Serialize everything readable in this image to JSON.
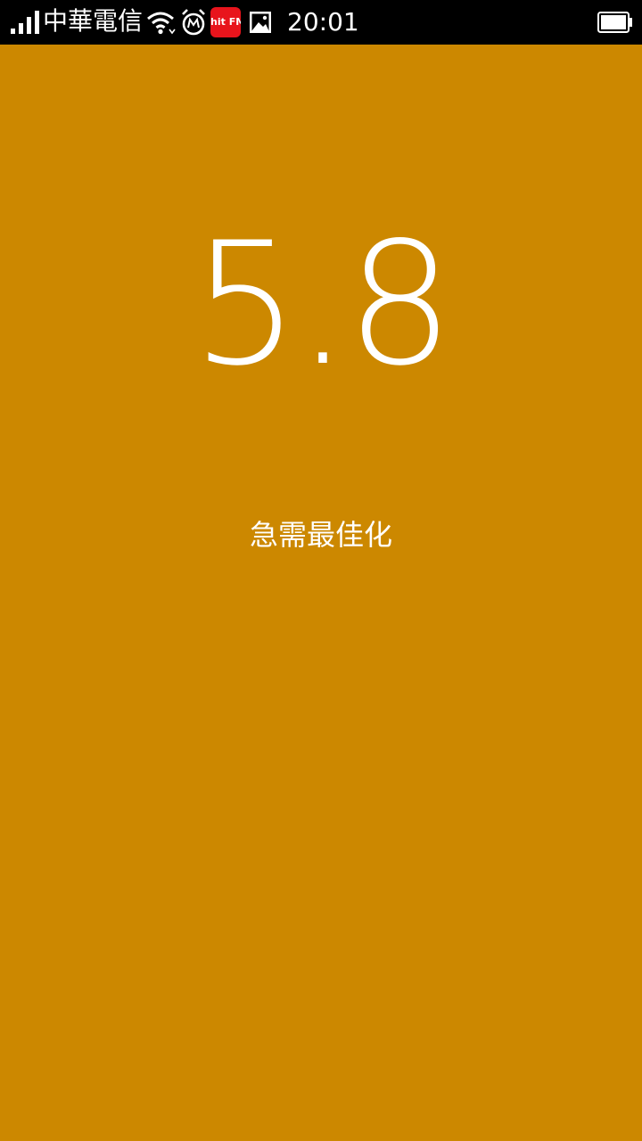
{
  "status_bar": {
    "carrier": "中華電信",
    "time": "20:01",
    "icons": [
      "signal-icon",
      "wifi-icon",
      "alarm-icon",
      "app-notification-icon",
      "gallery-icon",
      "battery-icon"
    ],
    "app_badge_text": "hit FM"
  },
  "main": {
    "score": "5.8",
    "status_text": "急需最佳化"
  },
  "colors": {
    "background": "#CC8800",
    "status_bar": "#000000",
    "text": "#FFFFFF",
    "app_badge": "#E8141C"
  }
}
